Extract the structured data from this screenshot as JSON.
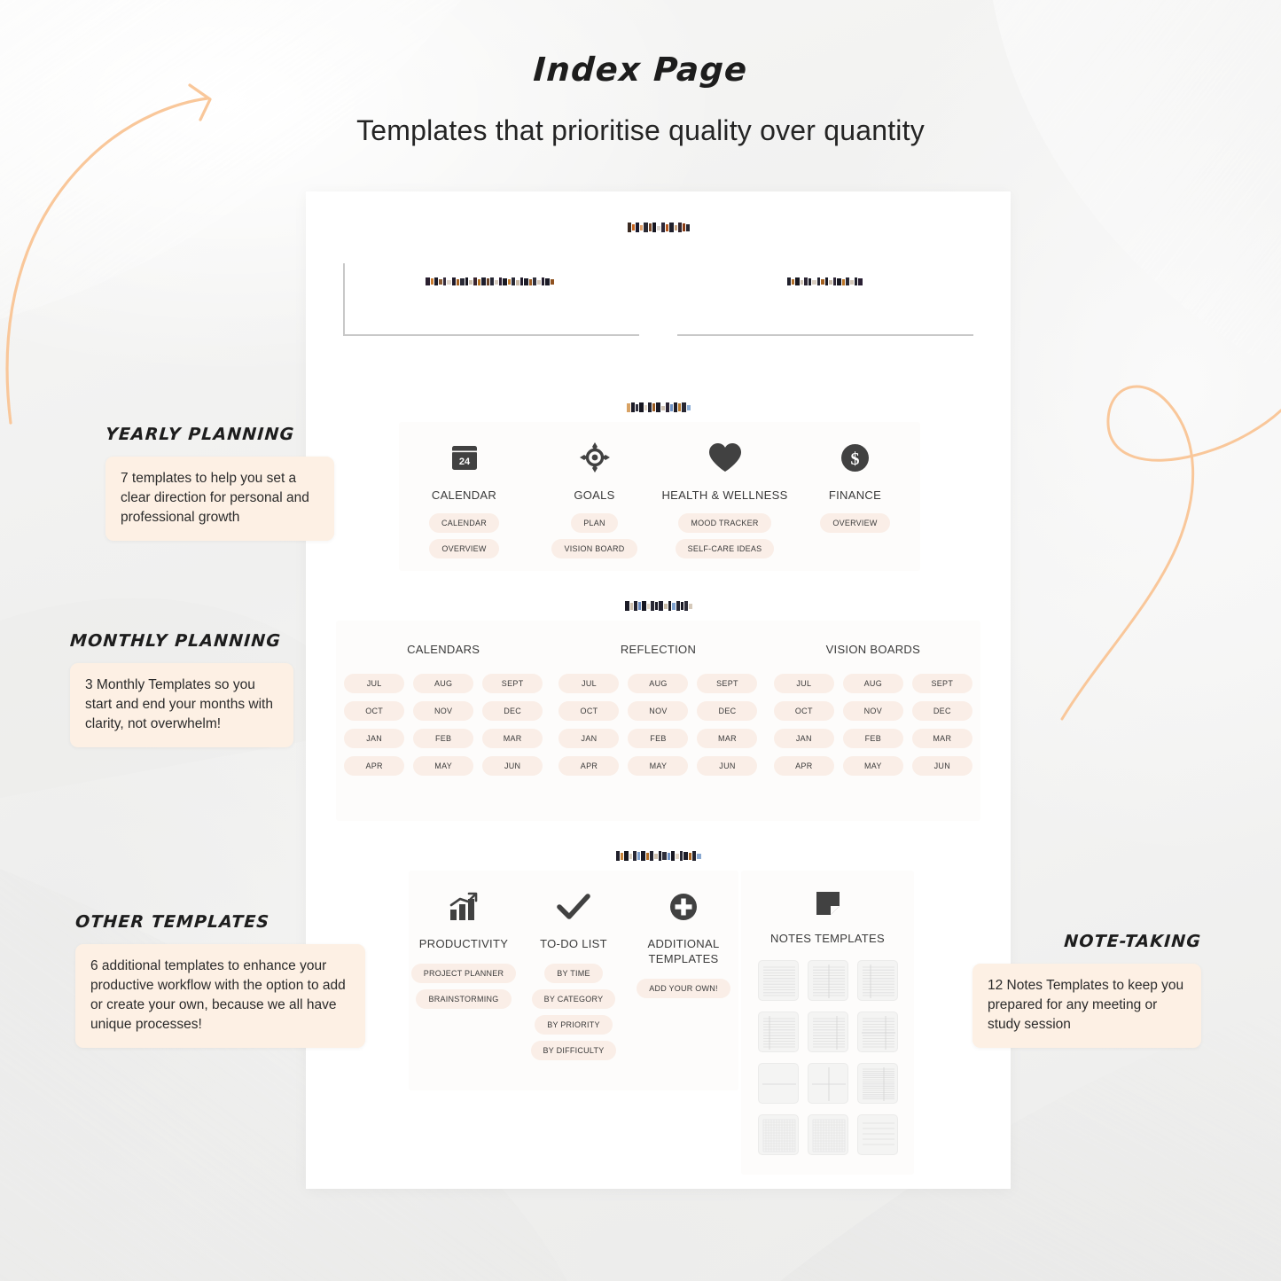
{
  "header": {
    "title": "Index Page",
    "subtitle": "Templates that prioritise quality over quantity"
  },
  "colors": {
    "background": "#f2f2f1",
    "sheet": "#ffffff",
    "card": "#fdfcfb",
    "pill": "#faeee7",
    "callout": "#fdf0e4",
    "accent_peach": "#f9c79a",
    "icon_dark": "#414141",
    "text_dark": "#2b2b2b",
    "rule": "#c8c8c8"
  },
  "sheet": {
    "index": {
      "heading": "INDEX",
      "heading_state": "pixelated",
      "columns": [
        {
          "label": "",
          "label_state": "pixelated",
          "rule": "l-shape"
        },
        {
          "label": "",
          "label_state": "pixelated",
          "rule": "bottom"
        }
      ]
    },
    "yearly": {
      "heading": "YEARLY",
      "heading_state": "pixelated",
      "columns": [
        {
          "icon": "calendar-icon",
          "icon_label": "24",
          "title": "CALENDAR",
          "pills": [
            "CALENDAR",
            "OVERVIEW"
          ]
        },
        {
          "icon": "target-icon",
          "icon_label": "",
          "title": "GOALS",
          "pills": [
            "PLAN",
            "VISION BOARD"
          ]
        },
        {
          "icon": "heart-icon",
          "icon_label": "",
          "title": "HEALTH & WELLNESS",
          "pills": [
            "MOOD TRACKER",
            "SELF-CARE IDEAS"
          ]
        },
        {
          "icon": "dollar-icon",
          "icon_label": "",
          "title": "FINANCE",
          "pills": [
            "OVERVIEW"
          ]
        }
      ]
    },
    "monthly": {
      "heading": "MONTHLY",
      "heading_state": "pixelated",
      "months": [
        "JUL",
        "AUG",
        "SEPT",
        "OCT",
        "NOV",
        "DEC",
        "JAN",
        "FEB",
        "MAR",
        "APR",
        "MAY",
        "JUN"
      ],
      "columns": [
        {
          "title": "CALENDARS"
        },
        {
          "title": "REFLECTION"
        },
        {
          "title": "VISION BOARDS"
        }
      ]
    },
    "templates": {
      "heading": "TEMPLATES",
      "heading_state": "pixelated",
      "columns": [
        {
          "icon": "bar-chart-icon",
          "title": "PRODUCTIVITY",
          "pills": [
            "PROJECT PLANNER",
            "BRAINSTORMING"
          ]
        },
        {
          "icon": "check-icon",
          "title": "TO-DO LIST",
          "pills": [
            "BY TIME",
            "BY CATEGORY",
            "BY PRIORITY",
            "BY DIFFICULTY"
          ]
        },
        {
          "icon": "plus-icon",
          "title": "ADDITIONAL TEMPLATES",
          "pills": [
            "ADD YOUR OWN!"
          ]
        }
      ]
    },
    "notes": {
      "icon": "note-page-icon",
      "title": "NOTES TEMPLATES",
      "thumbnails": [
        {
          "pattern": "lined"
        },
        {
          "pattern": "lined-two-col"
        },
        {
          "pattern": "lined-left-margin"
        },
        {
          "pattern": "lined-left-margin-narrow"
        },
        {
          "pattern": "lined-right-margin"
        },
        {
          "pattern": "lined-split-right"
        },
        {
          "pattern": "blank-halves"
        },
        {
          "pattern": "blank-quarters"
        },
        {
          "pattern": "lined-dense-split"
        },
        {
          "pattern": "grid-fine"
        },
        {
          "pattern": "grid-fine"
        },
        {
          "pattern": "lined-wide"
        }
      ]
    }
  },
  "annotations": [
    {
      "label": "YEARLY PLANNING",
      "text": "7 templates to help you set a clear direction for personal and professional growth"
    },
    {
      "label": "MONTHLY PLANNING",
      "text": "3 Monthly Templates so you start and end your months with clarity, not overwhelm!"
    },
    {
      "label": "OTHER TEMPLATES",
      "text": "6 additional templates to enhance your productive workflow with the option to add or create your own, because we all have unique processes!"
    },
    {
      "label": "NOTE-TAKING",
      "text": "12 Notes Templates to keep you prepared for any meeting or study session"
    }
  ],
  "decorations": [
    {
      "name": "curved-arrow",
      "color": "#f9c79a"
    },
    {
      "name": "loop-swirl",
      "color": "#f9c79a"
    }
  ]
}
